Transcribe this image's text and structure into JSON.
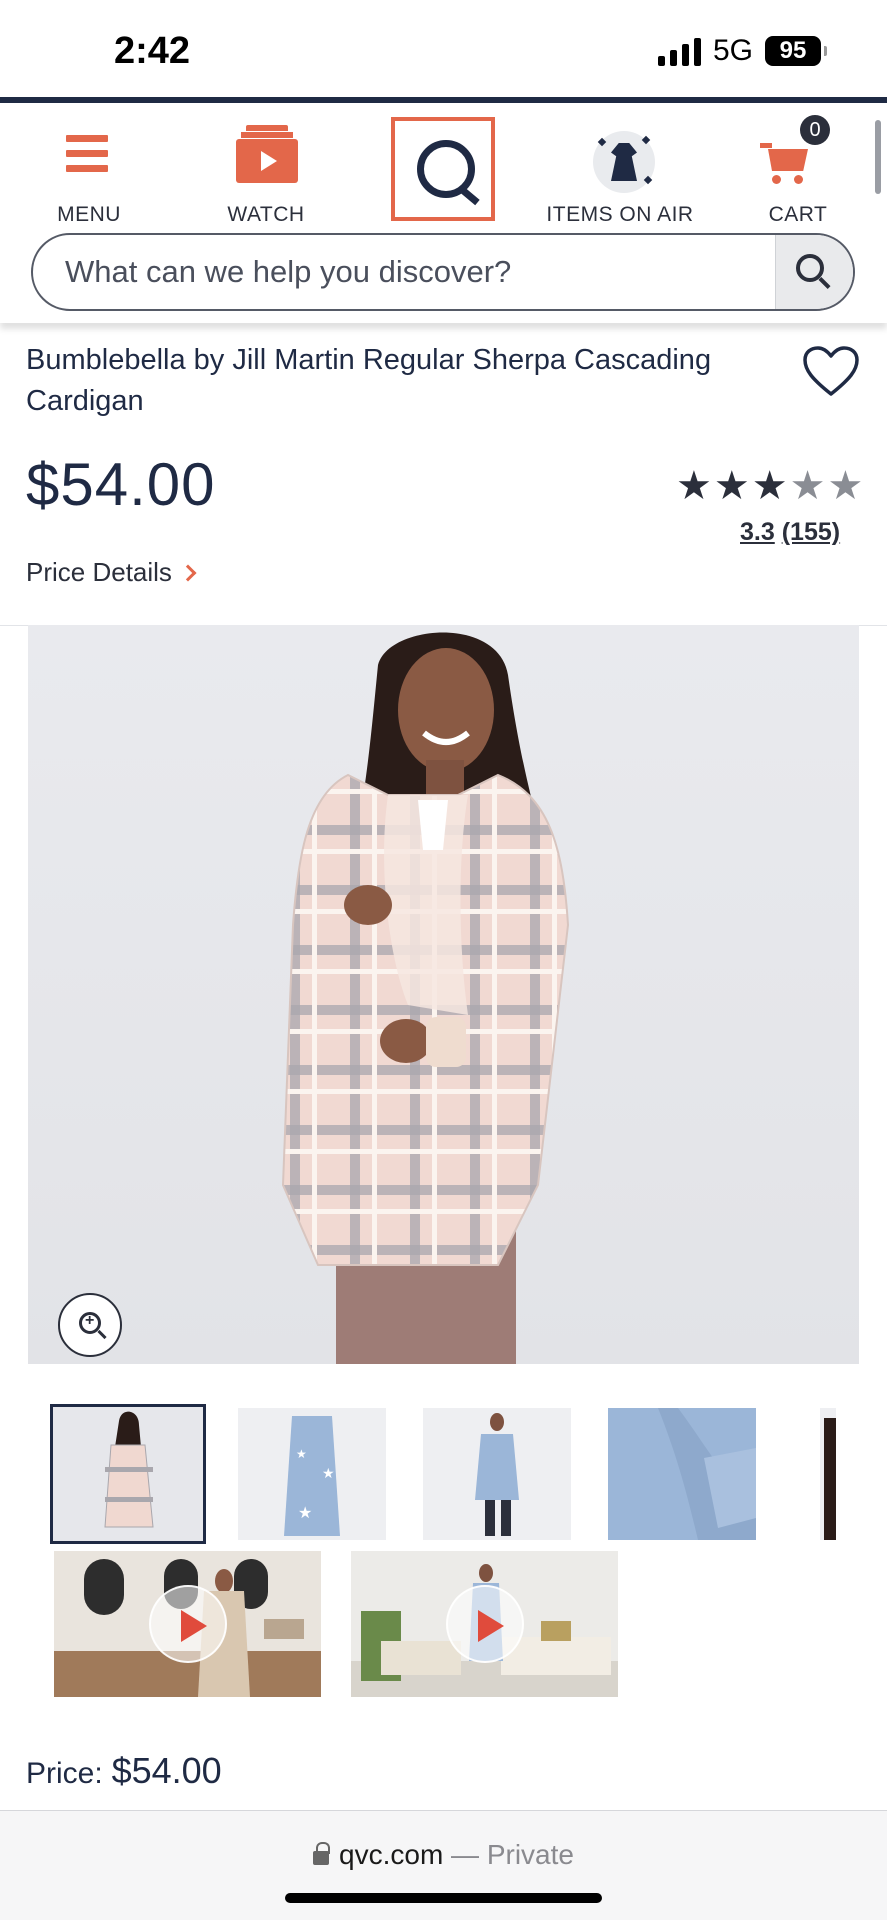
{
  "status_bar": {
    "time": "2:42",
    "network": "5G",
    "battery": "95"
  },
  "header": {
    "nav": [
      {
        "label": "MENU",
        "icon": "menu-icon"
      },
      {
        "label": "WATCH",
        "icon": "watch-icon"
      },
      {
        "label": "",
        "icon": "qvc-logo"
      },
      {
        "label": "ITEMS ON AIR",
        "icon": "dress-icon"
      },
      {
        "label": "CART",
        "icon": "cart-icon"
      }
    ],
    "cart_count": "0",
    "search": {
      "placeholder": "What can we help you discover?",
      "value": ""
    }
  },
  "product": {
    "title": "Bumblebella by Jill Martin Regular Sherpa Cascading Cardigan",
    "price": "$54.00",
    "rating": {
      "score": "3.3",
      "count": "(155)",
      "stars_value": 3.3,
      "stars_max": 5
    },
    "price_details_label": "Price Details",
    "thumbnails_count_visible": 5,
    "videos_count_visible": 2,
    "bottom_price_label": "Price:",
    "bottom_price_value": "$54.00"
  },
  "browser": {
    "domain": "qvc.com",
    "separator": "—",
    "mode": "Private"
  },
  "colors": {
    "accent": "#e3674a",
    "navy": "#1f2a44",
    "text": "#2b2f3b"
  }
}
